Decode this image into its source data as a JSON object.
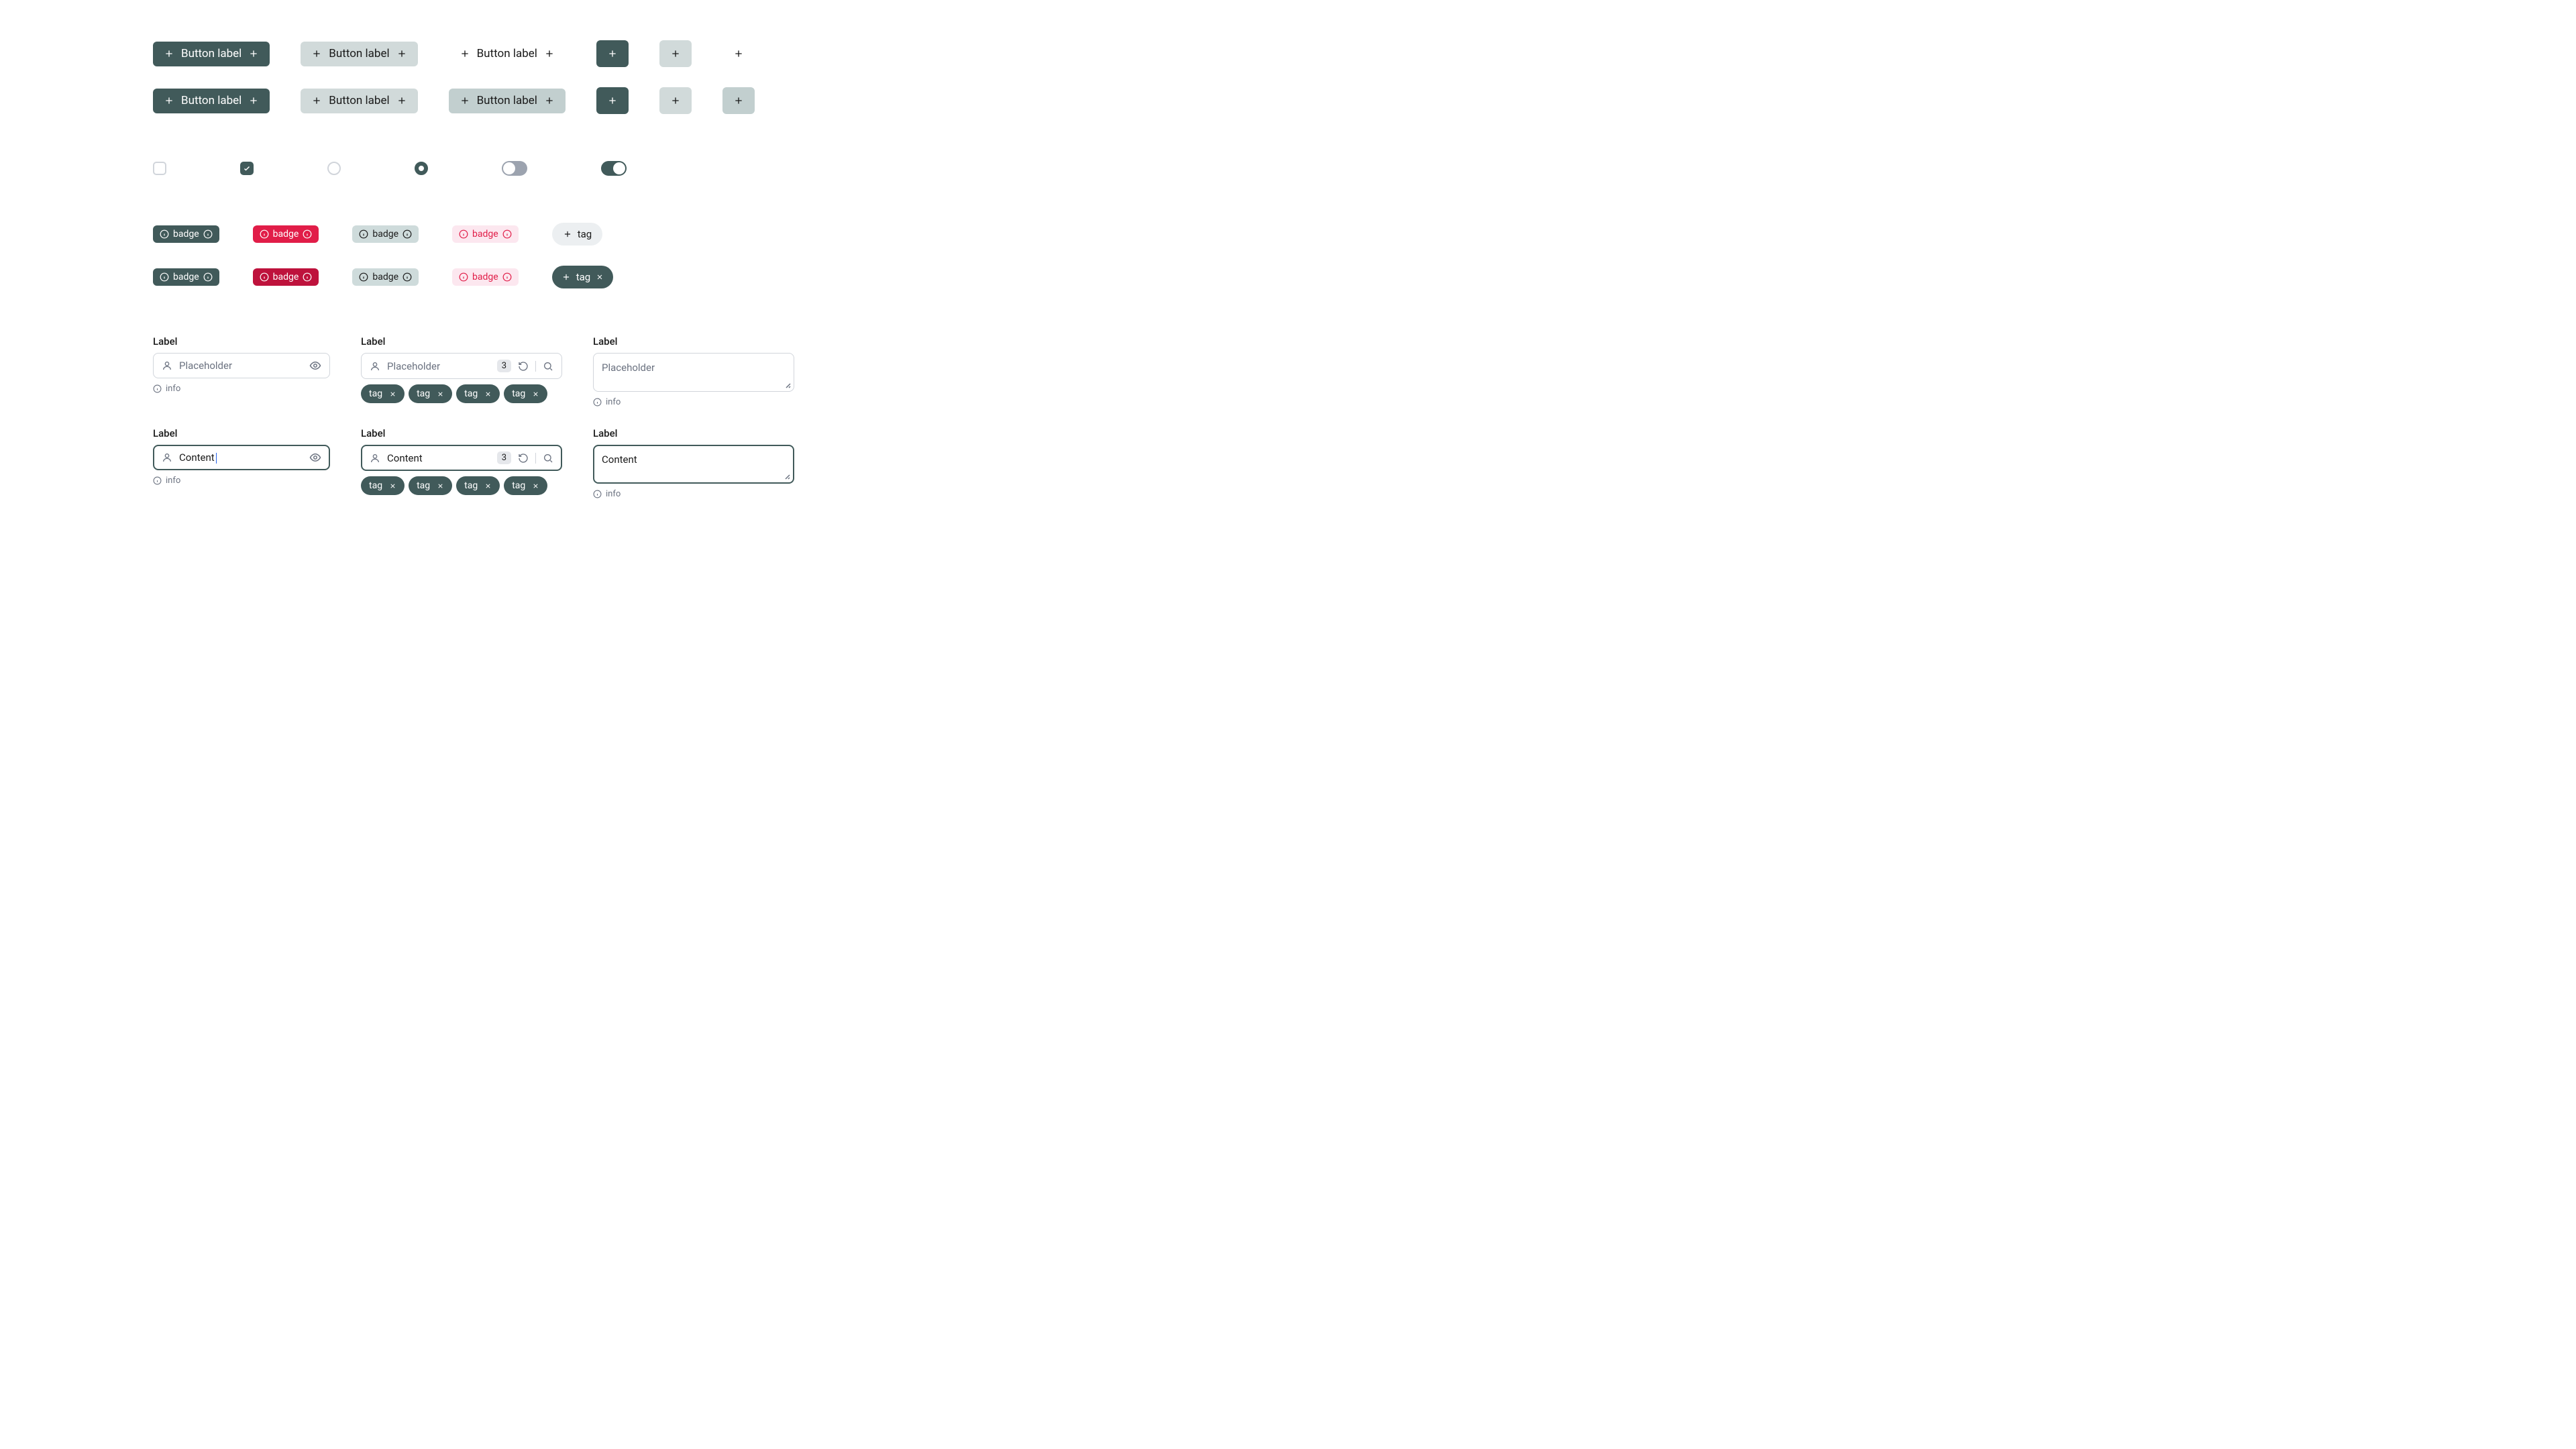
{
  "buttons": {
    "label": "Button label"
  },
  "badges": {
    "text": "badge"
  },
  "tags": {
    "text": "tag"
  },
  "fields": {
    "label": "Label",
    "placeholder": "Placeholder",
    "content": "Content",
    "info": "info",
    "count": "3"
  },
  "tag_chips": [
    "tag",
    "tag",
    "tag",
    "tag"
  ]
}
